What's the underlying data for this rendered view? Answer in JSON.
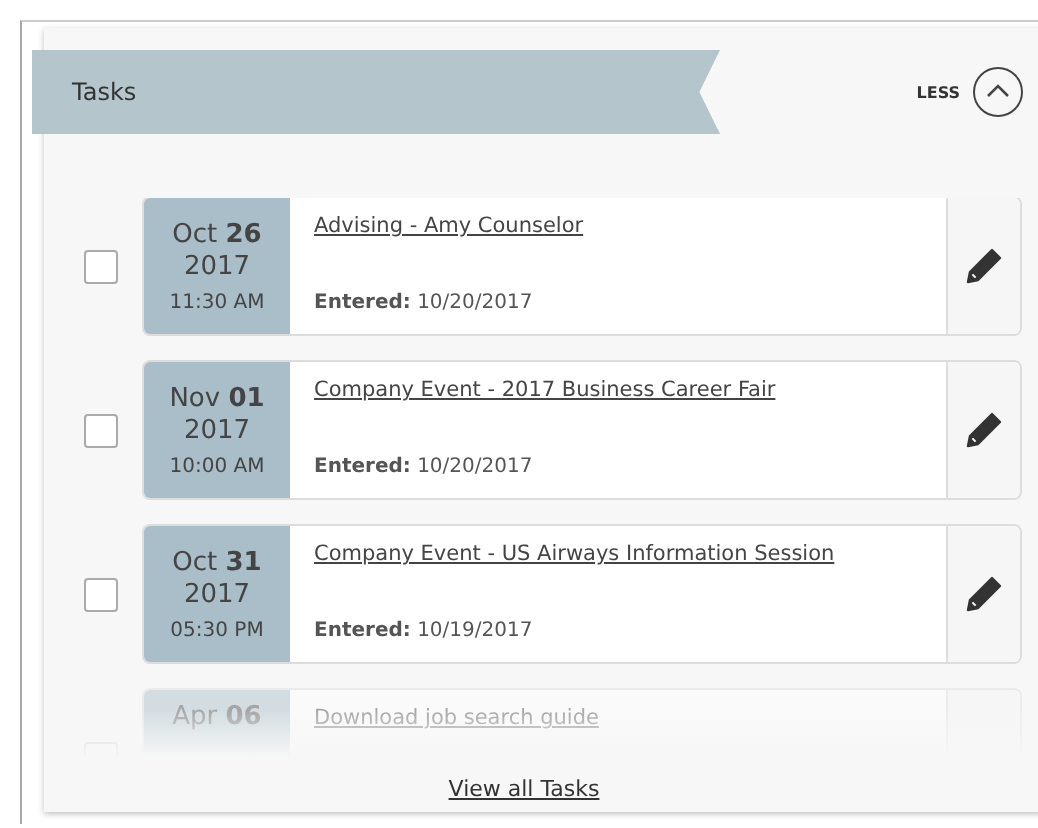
{
  "panel": {
    "title": "Tasks",
    "toggle": {
      "label": "LESS",
      "expanded": true
    }
  },
  "tasks": [
    {
      "month": "Oct",
      "day": "26",
      "year": "2017",
      "time": "11:30 AM",
      "title": "Advising - Amy Counselor",
      "entered_label": "Entered:",
      "entered": "10/20/2017",
      "checked": false,
      "faded": false
    },
    {
      "month": "Nov",
      "day": "01",
      "year": "2017",
      "time": "10:00 AM",
      "title": "Company Event - 2017 Business Career Fair",
      "entered_label": "Entered:",
      "entered": "10/20/2017",
      "checked": false,
      "faded": false
    },
    {
      "month": "Oct",
      "day": "31",
      "year": "2017",
      "time": "05:30 PM",
      "title": "Company Event - US Airways Information Session",
      "entered_label": "Entered:",
      "entered": "10/19/2017",
      "checked": false,
      "faded": false
    },
    {
      "month": "Apr",
      "day": "06",
      "title": "Download job search guide",
      "checked": false,
      "faded": true
    }
  ],
  "view_all": "View all Tasks"
}
